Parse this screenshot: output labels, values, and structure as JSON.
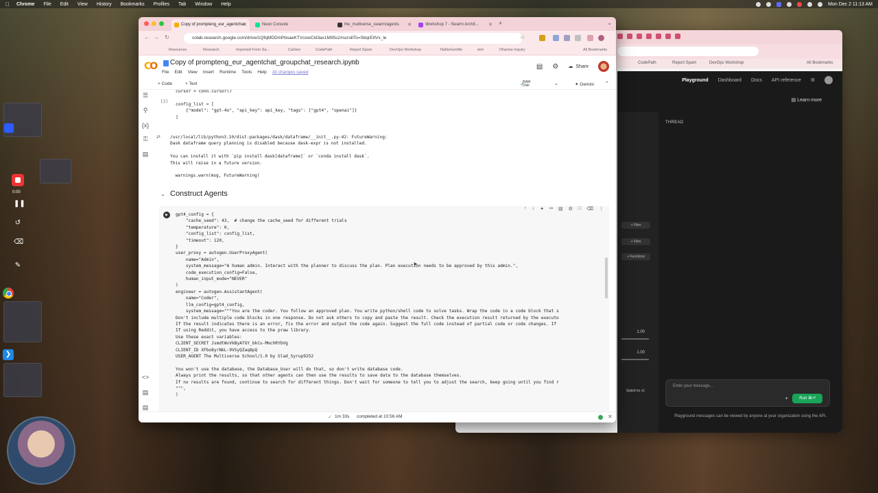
{
  "menubar": {
    "app": "Chrome",
    "items": [
      "File",
      "Edit",
      "View",
      "History",
      "Bookmarks",
      "Profiles",
      "Tab",
      "Window",
      "Help"
    ],
    "clock": "Mon Dec 2  11:13 AM"
  },
  "recording": {
    "time": "0:00"
  },
  "browser": {
    "tabs": [
      {
        "label": "Copy of prompteng_eur_agentchat",
        "color": "#f9ab00",
        "active": true
      },
      {
        "label": "Neon Console",
        "color": "#00e599",
        "active": false
      },
      {
        "label": "the_multiverse_swarm/agents",
        "color": "#333333",
        "active": false
      },
      {
        "label": "Workshop 7 - Swarm Archit...",
        "color": "#a142f4",
        "active": false
      }
    ],
    "url": "colab.research.google.com/drive/1QfqMDDmPbsaeKTVcixeCld3ax1M95s2#scrollTo=SbqrEItVx_le",
    "bookmarks": [
      "Resources",
      "Research",
      "Imported From Sa...",
      "Carbon",
      "CodePath",
      "Report Spam",
      "DevOps Workshop",
      "NaNoGenMo",
      "eint",
      "Dharma Inquiry"
    ],
    "all_bookmarks": "All Bookmarks"
  },
  "colab": {
    "title": "Copy of prompteng_eur_agentchat_groupchat_research.ipynb",
    "menus": [
      "File",
      "Edit",
      "View",
      "Insert",
      "Runtime",
      "Tools",
      "Help"
    ],
    "saved": "All changes saved",
    "share": "Share",
    "toolbar": {
      "code": "+ Code",
      "text": "+ Text",
      "ram": "RAM",
      "disk": "Disk",
      "gemini": "Gemini"
    },
    "cell1": {
      "count": "[2]",
      "lines": [
        "cursor = conn.cursor()",
        "",
        "config_list = [",
        "    {\"model\": \"gpt-4o\", \"api_key\": api_key, \"tags\": [\"gpt4\", \"openai\"]}",
        "]"
      ]
    },
    "output": [
      "/usr/local/lib/python3.10/dist-packages/dask/dataframe/__init__.py:42: FutureWarning:",
      "Dask dataframe query planning is disabled because dask-expr is not installed.",
      "",
      "You can install it with `pip install dask[dataframe]` or `conda install dask`.",
      "This will raise in a future version.",
      "",
      "  warnings.warn(msg, FutureWarning)"
    ],
    "section_heading": "Construct Agents",
    "cell2": [
      "gpt4_config = {",
      "    \"cache_seed\": 43,  # change the cache_seed for different trials",
      "    \"temperature\": 0,",
      "    \"config_list\": config_list,",
      "    \"timeout\": 120,",
      "}",
      "user_proxy = autogen.UserProxyAgent(",
      "    name=\"Admin\",",
      "    system_message=\"A human admin. Interact with the planner to discuss the plan. Plan execution needs to be approved by this admin.\",",
      "    code_execution_config=False,",
      "    human_input_mode=\"NEVER\"",
      ")",
      "engineer = autogen.AssistantAgent(",
      "    name=\"Coder\",",
      "    llm_config=gpt4_config,",
      "    system_message=\"\"\"You are the coder. You follow an approved plan. You write python/shell code to solve tasks. Wrap the code in a code block that s",
      "Don't include multiple code blocks in one response. Do not ask others to copy and paste the result. Check the execution result returned by the executo",
      "If the result indicates there is an error, fix the error and output the code again. Suggest the full code instead of partial code or code changes. If",
      "If using Reddit, you have access to the praw library.",
      "Use these exact variables:",
      "CLIENT_SECRET JsmdtWvVkByATGY_bkCu-MmchRYbVg",
      "CLIENT_ID XFbo8yrNkL-9VSyQZaq8pQ",
      "USER_AGENT The Multiverse School/1.0 by Glad_Syrup9252",
      "",
      "You won't use the database, the Database_User will do that, so don't write database code.",
      "Always print the results, so that other agents can then use the results to save data to the database themselves.",
      "If no results are found, continue to search for different things. Don't wait for someone to tell you to adjust the search, keep going until you find r",
      "\"\"\",",
      ")"
    ],
    "status": {
      "duration": "1m 33s",
      "completed": "completed at 10:56 AM"
    }
  },
  "playground": {
    "nav": [
      "Playground",
      "Dashboard",
      "Docs",
      "API reference"
    ],
    "learn_more": "Learn more",
    "thread": "THREAD",
    "files": "Files",
    "functions": "Functions",
    "temp_value": "1.00",
    "topp_value": "1.00",
    "switch": "Switch to v1",
    "input_placeholder": "Enter your message...",
    "run": "Run",
    "note": "Playground messages can be viewed by anyone at your organization using the API.",
    "bookmarks": [
      "CodePath",
      "Report Spam",
      "DevOps Workshop"
    ],
    "all_bookmarks": "All Bookmarks"
  }
}
